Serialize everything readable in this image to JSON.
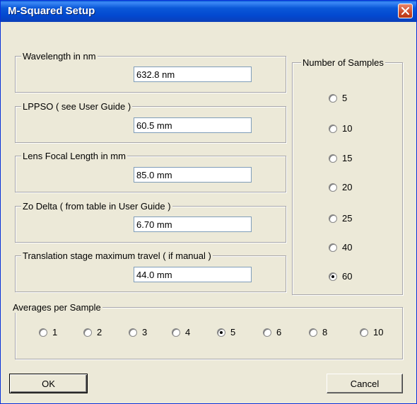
{
  "window": {
    "title": "M-Squared Setup"
  },
  "fields": [
    {
      "label": "Wavelength in nm",
      "value": "632.8 nm"
    },
    {
      "label": "LPPSO  ( see User Guide )",
      "value": "60.5 mm"
    },
    {
      "label": "Lens Focal Length in mm",
      "value": "85.0 mm"
    },
    {
      "label": "Zo Delta  ( from table in User Guide )",
      "value": "6.70 mm"
    },
    {
      "label": "Translation stage maximum travel  ( if manual )",
      "value": "44.0 mm"
    }
  ],
  "samples": {
    "label": "Number of Samples",
    "selected": "60",
    "options": [
      "5",
      "10",
      "15",
      "20",
      "25",
      "40",
      "60"
    ]
  },
  "averages": {
    "label": "Averages per Sample",
    "selected": "5",
    "options": [
      "1",
      "2",
      "3",
      "4",
      "5",
      "6",
      "8",
      "10"
    ]
  },
  "buttons": {
    "ok": "OK",
    "cancel": "Cancel"
  }
}
